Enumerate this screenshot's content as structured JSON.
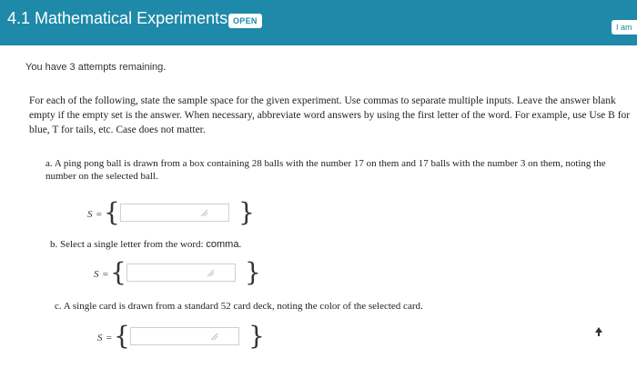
{
  "header": {
    "title": "4.1 Mathematical Experiments",
    "badge": "OPEN",
    "right_button": "I am"
  },
  "attempts_text": "You have 3 attempts remaining.",
  "instructions_text": "For each of the following, state the sample space for the given experiment. Use commas to separate multiple inputs. Leave the answer blank empty if the empty set is the answer. When necessary, abbreviate word answers by using the first letter of the word. For example, use Use B for blue, T for tails, etc. Case does not matter.",
  "parts": [
    {
      "marker": "a.",
      "text": "A ping pong ball is drawn from a box containing 28 balls with the number 17 on them and 17 balls with the number 3 on them, noting the number on the selected ball.",
      "s_label": "S",
      "equals": "=",
      "open_brace": "{",
      "close_brace": "}",
      "input_value": ""
    },
    {
      "marker": "b.",
      "text_prefix": "Select a single letter from the word: ",
      "word": "comma",
      "text_suffix": ".",
      "s_label": "S",
      "equals": "=",
      "open_brace": "{",
      "close_brace": "}",
      "input_value": ""
    },
    {
      "marker": "c.",
      "text": "A single card is drawn from a standard 52 card deck, noting the color of the selected card.",
      "s_label": "S",
      "equals": "=",
      "open_brace": "{",
      "close_brace": "}",
      "input_value": ""
    }
  ],
  "colors": {
    "header_bg": "#1e89a8",
    "header_text": "#ffffff"
  }
}
